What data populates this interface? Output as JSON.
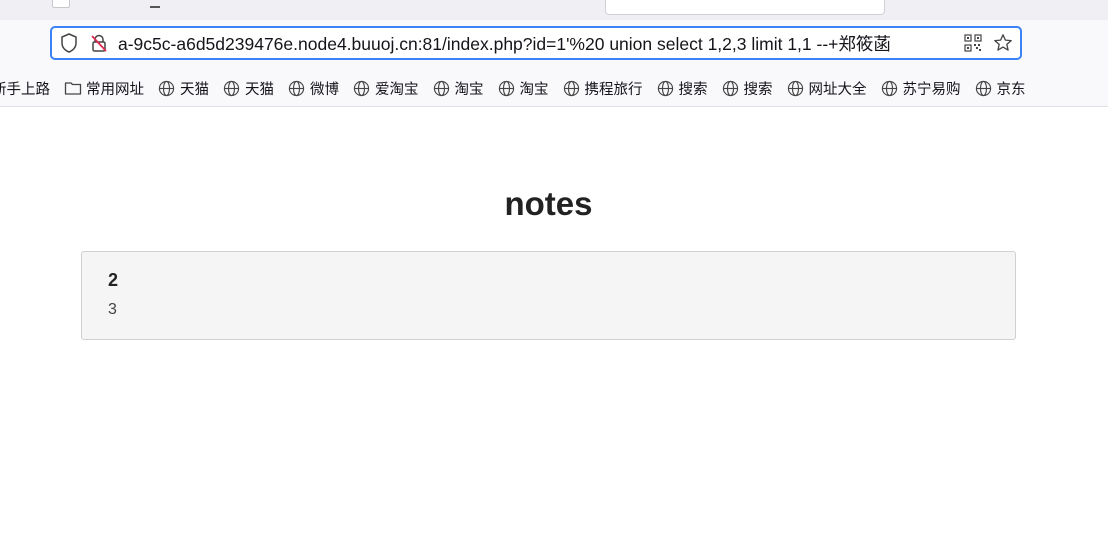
{
  "browser": {
    "url": "a-9c5c-a6d5d239476e.node4.buuoj.cn:81/index.php?id=1'%20 union select 1,2,3 limit 1,1 --+郑筱菡",
    "bookmarks": [
      {
        "label": "新手上路",
        "icon": "none"
      },
      {
        "label": "常用网址",
        "icon": "folder-icon"
      },
      {
        "label": "天猫",
        "icon": "globe-icon"
      },
      {
        "label": "天猫",
        "icon": "globe-icon"
      },
      {
        "label": "微博",
        "icon": "globe-icon"
      },
      {
        "label": "爱淘宝",
        "icon": "globe-icon"
      },
      {
        "label": "淘宝",
        "icon": "globe-icon"
      },
      {
        "label": "淘宝",
        "icon": "globe-icon"
      },
      {
        "label": "携程旅行",
        "icon": "globe-icon"
      },
      {
        "label": "搜索",
        "icon": "globe-icon"
      },
      {
        "label": "搜索",
        "icon": "globe-icon"
      },
      {
        "label": "网址大全",
        "icon": "globe-icon"
      },
      {
        "label": "苏宁易购",
        "icon": "globe-icon"
      },
      {
        "label": "京东",
        "icon": "globe-icon"
      }
    ]
  },
  "page": {
    "title": "notes",
    "note": {
      "title": "2",
      "body": "3"
    }
  },
  "colors": {
    "urlbar_focus": "#3b82f6",
    "card_bg": "#f5f5f5",
    "card_border": "#d0d0d0"
  }
}
